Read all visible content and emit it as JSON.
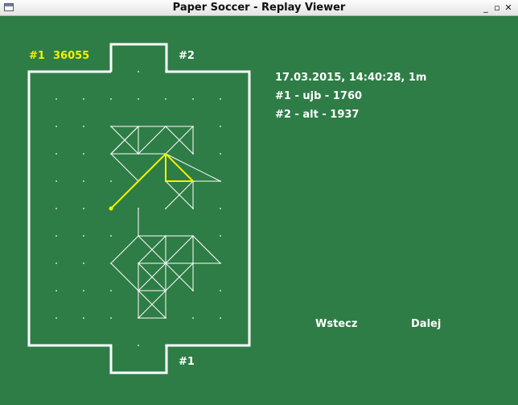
{
  "window": {
    "title": "Paper Soccer - Replay Viewer",
    "minimize_glyph": "_",
    "maximize_glyph": "▫",
    "close_glyph": "✕"
  },
  "board": {
    "player_top_label": "#1",
    "score": "36055",
    "goal_top_label": "#2",
    "goal_bottom_label": "#1",
    "colors": {
      "background": "#2e7d46",
      "lines": "#ffffff",
      "last_move": "#f3f200"
    }
  },
  "info": {
    "datetime": "17.03.2015, 14:40:28, 1m",
    "player1": "#1 - ujb - 1760",
    "player2": "#2 - alt - 1937"
  },
  "buttons": {
    "back": "Wstecz",
    "next": "Dalej"
  }
}
